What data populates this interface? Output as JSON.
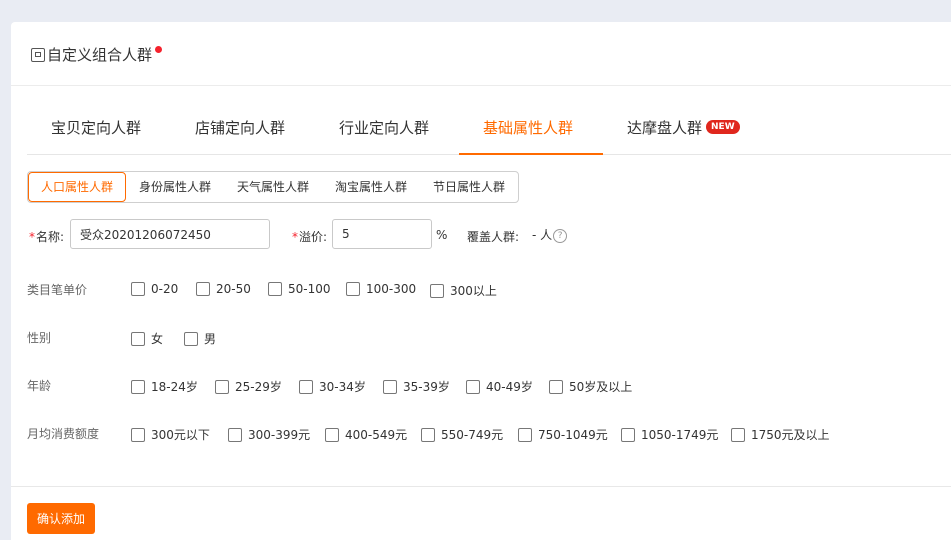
{
  "header": {
    "title": "自定义组合人群",
    "icon": "crowd-icon"
  },
  "tabs": [
    {
      "label": "宝贝定向人群"
    },
    {
      "label": "店铺定向人群"
    },
    {
      "label": "行业定向人群"
    },
    {
      "label": "基础属性人群"
    },
    {
      "label": "达摩盘人群",
      "badge": "NEW"
    }
  ],
  "active_tab": "基础属性人群",
  "subtabs": [
    {
      "label": "人口属性人群"
    },
    {
      "label": "身份属性人群"
    },
    {
      "label": "天气属性人群"
    },
    {
      "label": "淘宝属性人群"
    },
    {
      "label": "节日属性人群"
    }
  ],
  "active_subtab": "人口属性人群",
  "form": {
    "name_label": "名称:",
    "name_value": "受众20201206072450",
    "premium_label": "溢价:",
    "premium_value": "5",
    "premium_unit": "%",
    "coverage_label": "覆盖人群:",
    "coverage_value": "- 人",
    "required_mark": "*"
  },
  "groups": [
    {
      "label": "类目笔单价",
      "options": [
        "0-20",
        "20-50",
        "50-100",
        "100-300",
        "300以上"
      ]
    },
    {
      "label": "性别",
      "options": [
        "女",
        "男"
      ]
    },
    {
      "label": "年龄",
      "options": [
        "18-24岁",
        "25-29岁",
        "30-34岁",
        "35-39岁",
        "40-49岁",
        "50岁及以上"
      ]
    },
    {
      "label": "月均消费额度",
      "options": [
        "300元以下",
        "300-399元",
        "400-549元",
        "550-749元",
        "750-1049元",
        "1050-1749元",
        "1750元及以上"
      ]
    }
  ],
  "confirm_button": "确认添加",
  "colors": {
    "accent": "#ff6a00",
    "badge": "#e0271d",
    "required": "#f5222d"
  }
}
